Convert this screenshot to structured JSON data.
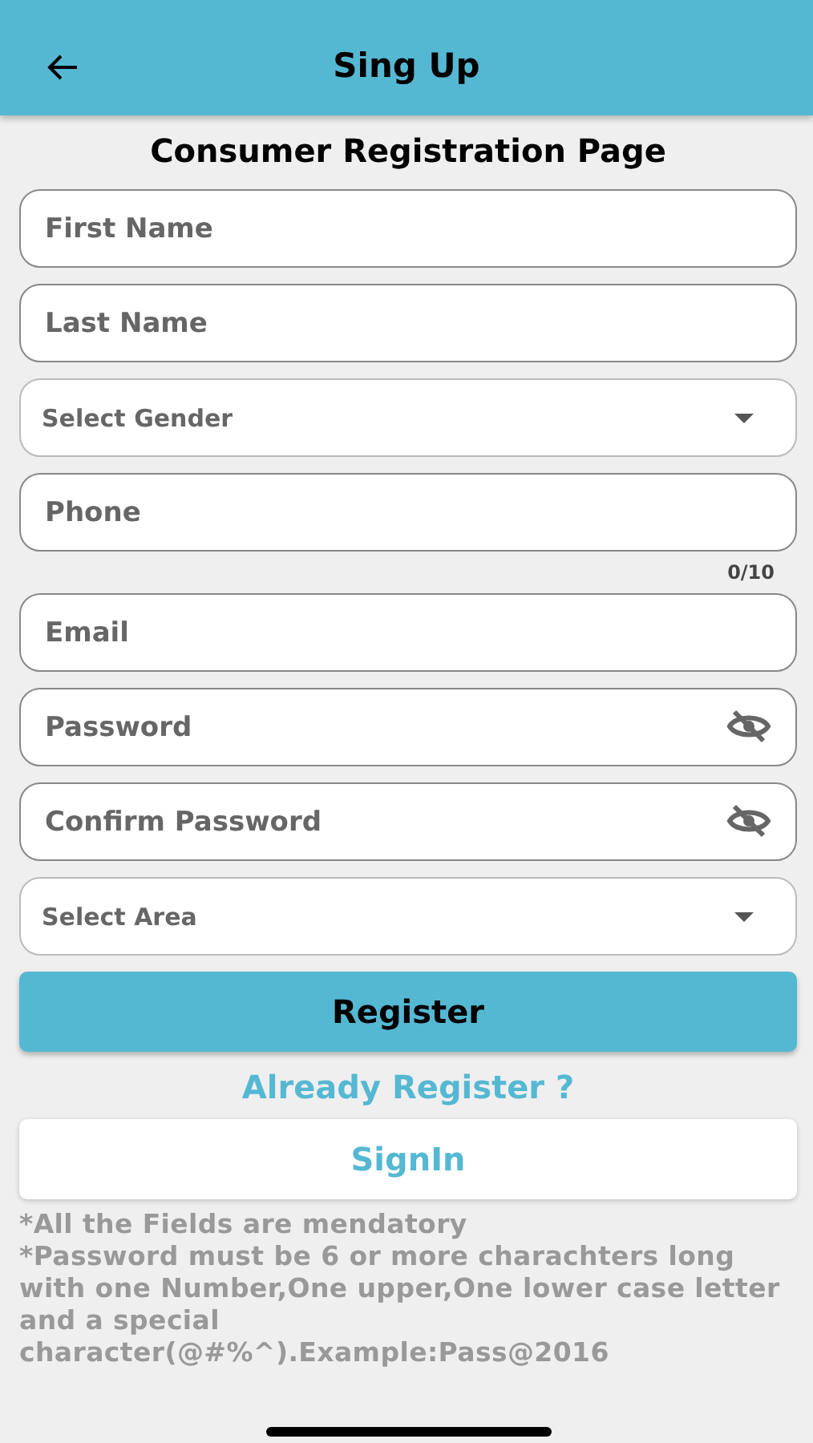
{
  "header": {
    "title": "Sing Up"
  },
  "page_title": "Consumer Registration Page",
  "fields": [
    {
      "kind": "text",
      "placeholder": "First Name"
    },
    {
      "kind": "text",
      "placeholder": "Last Name"
    },
    {
      "kind": "select",
      "placeholder": "Select Gender"
    },
    {
      "kind": "text",
      "placeholder": "Phone",
      "counter": "0/10"
    },
    {
      "kind": "text",
      "placeholder": "Email"
    },
    {
      "kind": "password",
      "placeholder": "Password"
    },
    {
      "kind": "password",
      "placeholder": "Confirm Password"
    },
    {
      "kind": "select",
      "placeholder": "Select Area"
    }
  ],
  "register_button": "Register",
  "already_registered": "Already Register ?",
  "signin_button": "SignIn",
  "notes": [
    "*All the Fields are mendatory",
    "*Password must be 6 or more charachters long with one Number,One upper,One lower case letter and a special character(@#%^).Example:Pass@2016"
  ]
}
